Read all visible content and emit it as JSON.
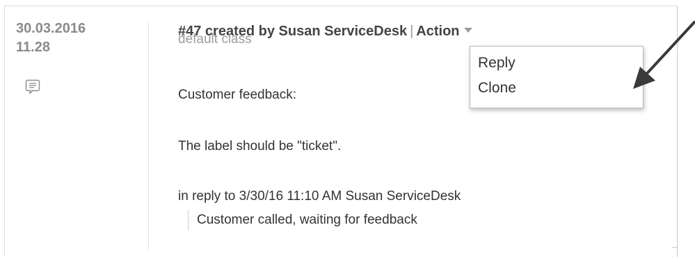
{
  "entry": {
    "date": "30.03.2016",
    "time": "11.28",
    "note_icon": "speech-bubble-note-icon",
    "header": {
      "title": "#47 created by Susan ServiceDesk",
      "separator": "|",
      "action_label": "Action",
      "action_icon": "caret-down-icon"
    },
    "class_label": "default class",
    "body_lines": [
      "Customer feedback:",
      "The label should be \"ticket\"."
    ],
    "reply_info": "in reply to 3/30/16 11:10 AM Susan ServiceDesk",
    "quoted_text": "Customer called, waiting for feedback"
  },
  "action_menu": {
    "items": [
      {
        "label": "Reply"
      },
      {
        "label": "Clone"
      }
    ]
  },
  "annotation": {
    "arrow_icon": "pointer-arrow-icon",
    "color": "#3a3a3a"
  }
}
